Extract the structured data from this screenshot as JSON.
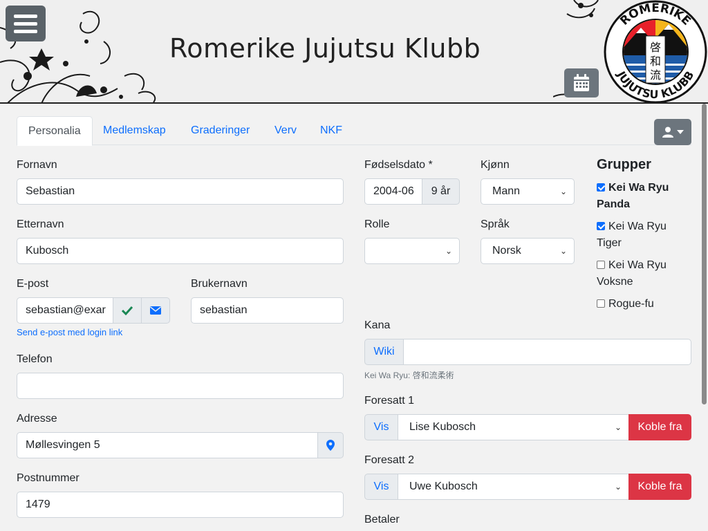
{
  "header": {
    "title": "Romerike Jujutsu Klubb",
    "logo_top_text": "ROMERIKE",
    "logo_bottom_text": "JUJUTSU KLUBB",
    "logo_kanji": [
      "啓",
      "和",
      "流"
    ]
  },
  "tabs": [
    {
      "label": "Personalia",
      "active": true
    },
    {
      "label": "Medlemskap",
      "active": false
    },
    {
      "label": "Graderinger",
      "active": false
    },
    {
      "label": "Verv",
      "active": false
    },
    {
      "label": "NKF",
      "active": false
    }
  ],
  "form": {
    "fornavn_label": "Fornavn",
    "fornavn_value": "Sebastian",
    "etternavn_label": "Etternavn",
    "etternavn_value": "Kubosch",
    "epost_label": "E-post",
    "epost_value": "sebastian@exar",
    "send_link": "Send e-post med login link",
    "brukernavn_label": "Brukernavn",
    "brukernavn_value": "sebastian",
    "telefon_label": "Telefon",
    "telefon_value": "",
    "adresse_label": "Adresse",
    "adresse_value": "Møllesvingen 5",
    "postnummer_label": "Postnummer",
    "postnummer_value": "1479",
    "fodselsdato_label": "Fødselsdato *",
    "fodselsdato_value": "2004-06",
    "alder_value": "9 år",
    "kjonn_label": "Kjønn",
    "kjonn_value": "Mann",
    "rolle_label": "Rolle",
    "rolle_value": "",
    "sprak_label": "Språk",
    "sprak_value": "Norsk",
    "kana_label": "Kana",
    "kana_addon": "Wiki",
    "kana_value": "",
    "kana_hint": "Kei Wa Ryu: 啓和流柔術",
    "foresatt1_label": "Foresatt 1",
    "foresatt1_addon": "Vis",
    "foresatt1_value": "Lise Kubosch",
    "foresatt1_button": "Koble fra",
    "foresatt2_label": "Foresatt 2",
    "foresatt2_addon": "Vis",
    "foresatt2_value": "Uwe Kubosch",
    "foresatt2_button": "Koble fra",
    "betaler_label": "Betaler"
  },
  "groups": {
    "title": "Grupper",
    "items": [
      {
        "line1": "Kei Wa Ryu",
        "line2": "Panda",
        "checked": true,
        "bold": true
      },
      {
        "line1": "Kei Wa Ryu",
        "line2": "Tiger",
        "checked": true,
        "bold": false
      },
      {
        "line1": "Kei Wa Ryu",
        "line2": "Voksne",
        "checked": false,
        "bold": false
      },
      {
        "line1": "Rogue-fu",
        "line2": "",
        "checked": false,
        "bold": false
      }
    ]
  },
  "colors": {
    "primary": "#0d6efd",
    "secondary": "#6c757d",
    "danger": "#dc3545",
    "success": "#198754"
  }
}
